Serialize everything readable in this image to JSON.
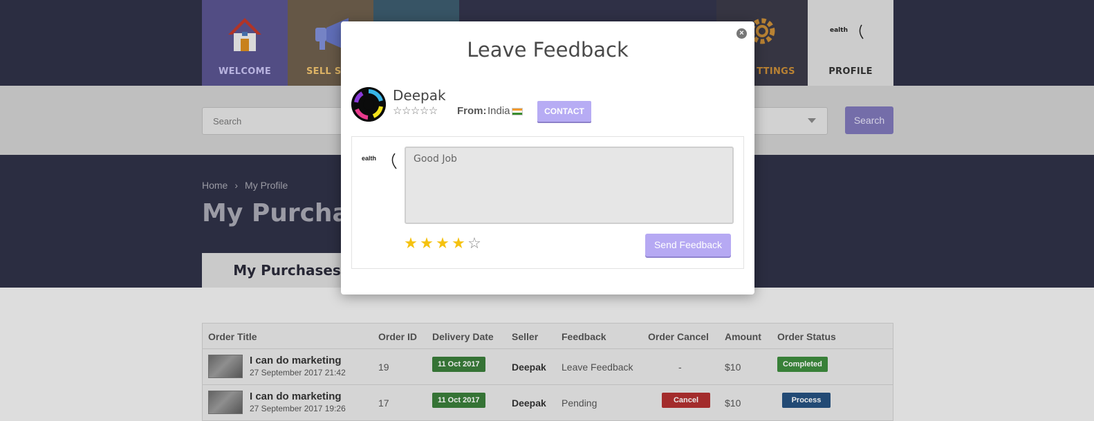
{
  "topnav": {
    "tiles": [
      {
        "label": "WELCOME",
        "icon": "house-icon"
      },
      {
        "label": "SELL SER",
        "icon": "megaphone-icon"
      },
      {
        "label": "",
        "icon": "generic-icon"
      },
      {
        "label": "",
        "icon": "generic-icon"
      },
      {
        "label": "",
        "icon": "generic-icon"
      },
      {
        "label": "",
        "icon": "generic-icon"
      },
      {
        "label": "TTINGS",
        "icon": "gear-icon"
      },
      {
        "label": "PROFILE",
        "icon": "logo-icon"
      }
    ]
  },
  "searchbar": {
    "placeholder": "Search",
    "button_label": "Search"
  },
  "breadcrumb": {
    "home": "Home",
    "current": "My Profile"
  },
  "page_heading": "My Purchas",
  "tab_label": "My Purchases",
  "orders": {
    "columns": [
      "Order Title",
      "Order ID",
      "Delivery Date",
      "Seller",
      "Feedback",
      "Order Cancel",
      "Amount",
      "Order Status"
    ],
    "rows": [
      {
        "title": "I can do marketing",
        "date": "27 September 2017 21:42",
        "id": "19",
        "delivery": "11 Oct 2017",
        "seller": "Deepak",
        "feedback": "Leave Feedback",
        "cancel": "-",
        "amount": "$10",
        "status": "Completed"
      },
      {
        "title": "I can do marketing",
        "date": "27 September 2017 19:26",
        "id": "17",
        "delivery": "11 Oct 2017",
        "seller": "Deepak",
        "feedback": "Pending",
        "cancel": "Cancel",
        "amount": "$10",
        "status": "Process"
      }
    ]
  },
  "modal": {
    "title": "Leave Feedback",
    "close_glyph": "×",
    "seller_name": "Deepak",
    "seller_stars": "☆☆☆☆☆",
    "from_label": "From:",
    "from_value": "India",
    "contact_label": "CONTACT",
    "logo_text": "ealth",
    "feedback_text": "Good Job",
    "rating": 4,
    "rating_max": 5,
    "send_label": "Send Feedback"
  },
  "colors": {
    "nav_bg": "#2f3147",
    "accent_purple": "#b7acf4",
    "star_gold": "#f5c20f",
    "completed_green": "#3d8b3d",
    "cancel_red": "#b13030",
    "process_blue": "#25517f"
  }
}
